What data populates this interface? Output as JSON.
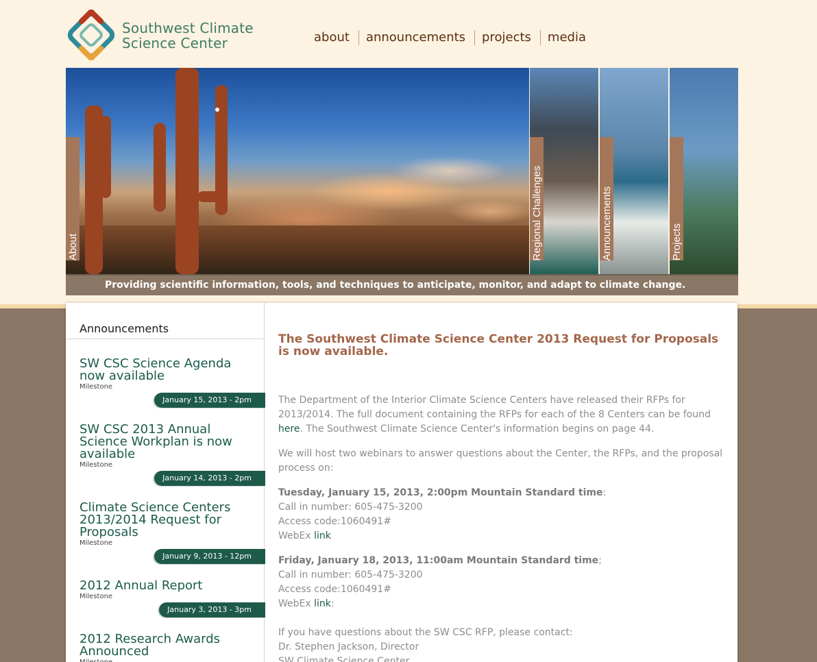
{
  "brand": {
    "line1": "Southwest Climate",
    "line2": "Science Center"
  },
  "nav": {
    "items": [
      "about",
      "announcements",
      "projects",
      "media"
    ]
  },
  "banner": {
    "tabs": [
      "About",
      "Regional Challenges",
      "Announcements",
      "Projects"
    ],
    "tagline": "Providing scientific information, tools, and techniques to anticipate, monitor, and adapt to climate change."
  },
  "sidebar": {
    "title": "Announcements",
    "items": [
      {
        "title": "SW CSC Science Agenda now available",
        "type": "Milestone",
        "date": "January 15, 2013 - 2pm"
      },
      {
        "title": "SW CSC 2013 Annual Science Workplan is now available",
        "type": "Milestone",
        "date": "January 14, 2013 - 2pm"
      },
      {
        "title": "Climate Science Centers 2013/2014 Request for Proposals",
        "type": "Milestone",
        "date": "January 9, 2013 - 12pm"
      },
      {
        "title": "2012 Annual Report",
        "type": "Milestone",
        "date": "January 3, 2013 - 3pm"
      },
      {
        "title": "2012 Research Awards Announced",
        "type": "Milestone",
        "date": ""
      }
    ]
  },
  "article": {
    "title": "The Southwest Climate Science Center 2013 Request for Proposals is now available.",
    "p1_a": "The Department of the Interior Climate Science Centers have released their RFPs for 2013/2014. The full document containing the RFPs for each of the 8 Centers can be found ",
    "p1_link": "here",
    "p1_b": ".  The Southwest Climate Science Center's information begins on page 44.",
    "p2": "We will host two webinars to answer questions about the Center, the RFPs, and the proposal process on:",
    "webinar1": {
      "heading": "Tuesday, January 15, 2013, 2:00pm Mountain Standard time",
      "heading_suffix": ":",
      "call": "Call in number: 605-475-3200",
      "access": "Access code:1060491#",
      "webex": "WebEx ",
      "link": "link",
      "link_suffix": ""
    },
    "webinar2": {
      "heading": "Friday, January 18, 2013, 11:00am Mountain Standard time",
      "heading_suffix": ";",
      "call": "Call in number: 605-475-3200",
      "access": "Access code:1060491#",
      "webex": "WebEx ",
      "link": "link",
      "link_suffix": ":"
    },
    "contact_intro": "If you have questions about the SW CSC RFP, please contact:",
    "contact_name": "Dr. Stephen Jackson, Director",
    "contact_org": "SW Climate Science Center"
  }
}
